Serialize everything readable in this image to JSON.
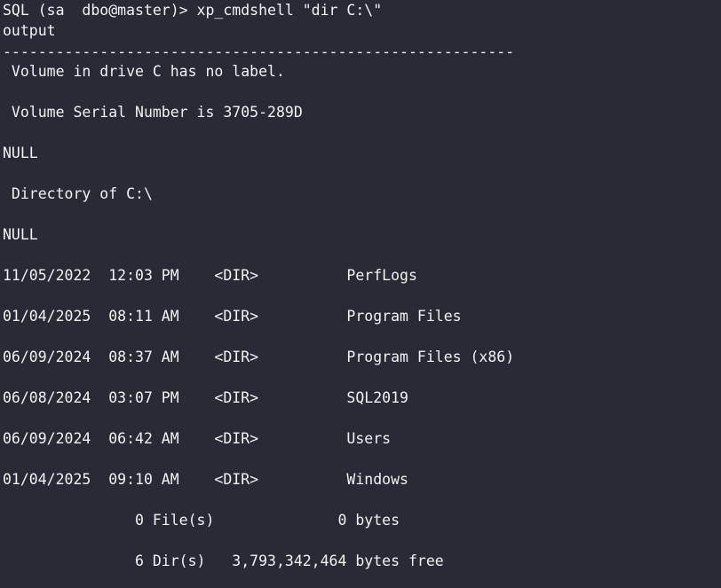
{
  "terminal": {
    "prompt": "SQL (sa  dbo@master)> ",
    "command": "xp_cmdshell \"dir C:\\\"",
    "column_header": "output",
    "separator": "----------------------------------------------------------",
    "output_lines": [
      " Volume in drive C has no label.",
      "",
      " Volume Serial Number is 3705-289D",
      "",
      "NULL",
      "",
      " Directory of C:\\",
      "",
      "NULL",
      "",
      "11/05/2022  12:03 PM    <DIR>          PerfLogs",
      "",
      "01/04/2025  08:11 AM    <DIR>          Program Files",
      "",
      "06/09/2024  08:37 AM    <DIR>          Program Files (x86)",
      "",
      "06/08/2024  03:07 PM    <DIR>          SQL2019",
      "",
      "06/09/2024  06:42 AM    <DIR>          Users",
      "",
      "01/04/2025  09:10 AM    <DIR>          Windows",
      "",
      "               0 File(s)              0 bytes",
      "",
      "               6 Dir(s)   3,793,342,464 bytes free"
    ]
  }
}
